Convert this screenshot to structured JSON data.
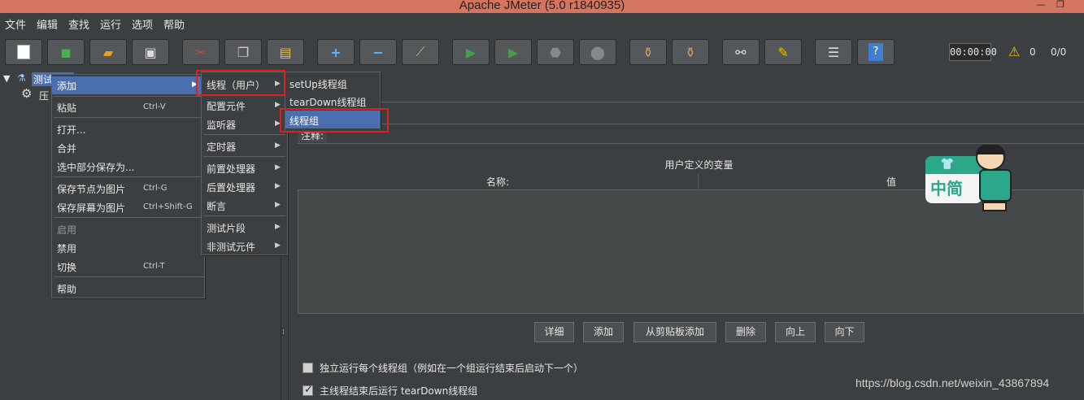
{
  "window": {
    "title": "Apache JMeter (5.0 r1840935)"
  },
  "menubar": [
    "文件",
    "编辑",
    "查找",
    "运行",
    "选项",
    "帮助"
  ],
  "toolbar": {
    "icons": [
      "new-icon",
      "templates-icon",
      "open-icon",
      "save-icon",
      "cut-icon",
      "copy-icon",
      "paste-icon",
      "expand-icon",
      "collapse-icon",
      "toggle-icon",
      "start-icon",
      "start-no-pause-icon",
      "stop-icon",
      "shutdown-icon",
      "clear-icon",
      "clear-all-icon",
      "search-icon",
      "reset-search-icon",
      "function-helper-icon",
      "help-icon"
    ],
    "timer": "00:00:00",
    "warnings": "0",
    "threads": "0/0"
  },
  "tree": {
    "root_label": "测试计划",
    "child_label": "压"
  },
  "menu_main": {
    "items": [
      {
        "label": "添加",
        "shortcut": "",
        "arrow": true,
        "active": true
      },
      {
        "label": "粘贴",
        "shortcut": "Ctrl-V"
      },
      {
        "label": "打开...",
        "shortcut": ""
      },
      {
        "label": "合并",
        "shortcut": ""
      },
      {
        "label": "选中部分保存为...",
        "shortcut": ""
      },
      {
        "label": "保存节点为图片",
        "shortcut": "Ctrl-G"
      },
      {
        "label": "保存屏幕为图片",
        "shortcut": "Ctrl+Shift-G"
      },
      {
        "label": "启用",
        "shortcut": "",
        "disabled": true
      },
      {
        "label": "禁用",
        "shortcut": ""
      },
      {
        "label": "切换",
        "shortcut": "Ctrl-T"
      },
      {
        "label": "帮助",
        "shortcut": ""
      }
    ]
  },
  "menu_add": {
    "items": [
      "线程（用户）",
      "配置元件",
      "监听器",
      "定时器",
      "前置处理器",
      "后置处理器",
      "断言",
      "测试片段",
      "非测试元件"
    ]
  },
  "menu_threads": {
    "items": [
      "setUp线程组",
      "tearDown线程组",
      "线程组"
    ]
  },
  "content": {
    "comment_label": "注释:",
    "table_title": "用户定义的变量",
    "col_name": "名称:",
    "col_value": "值",
    "buttons": [
      "详细",
      "添加",
      "从剪贴板添加",
      "删除",
      "向上",
      "向下"
    ],
    "check1": "独立运行每个线程组（例如在一个组运行结束后启动下一个）",
    "check2": "主线程结束后运行 tearDown线程组",
    "check1_checked": false,
    "check2_checked": true
  },
  "mascot_text": "中简",
  "watermark": "https://blog.csdn.net/weixin_43867894"
}
